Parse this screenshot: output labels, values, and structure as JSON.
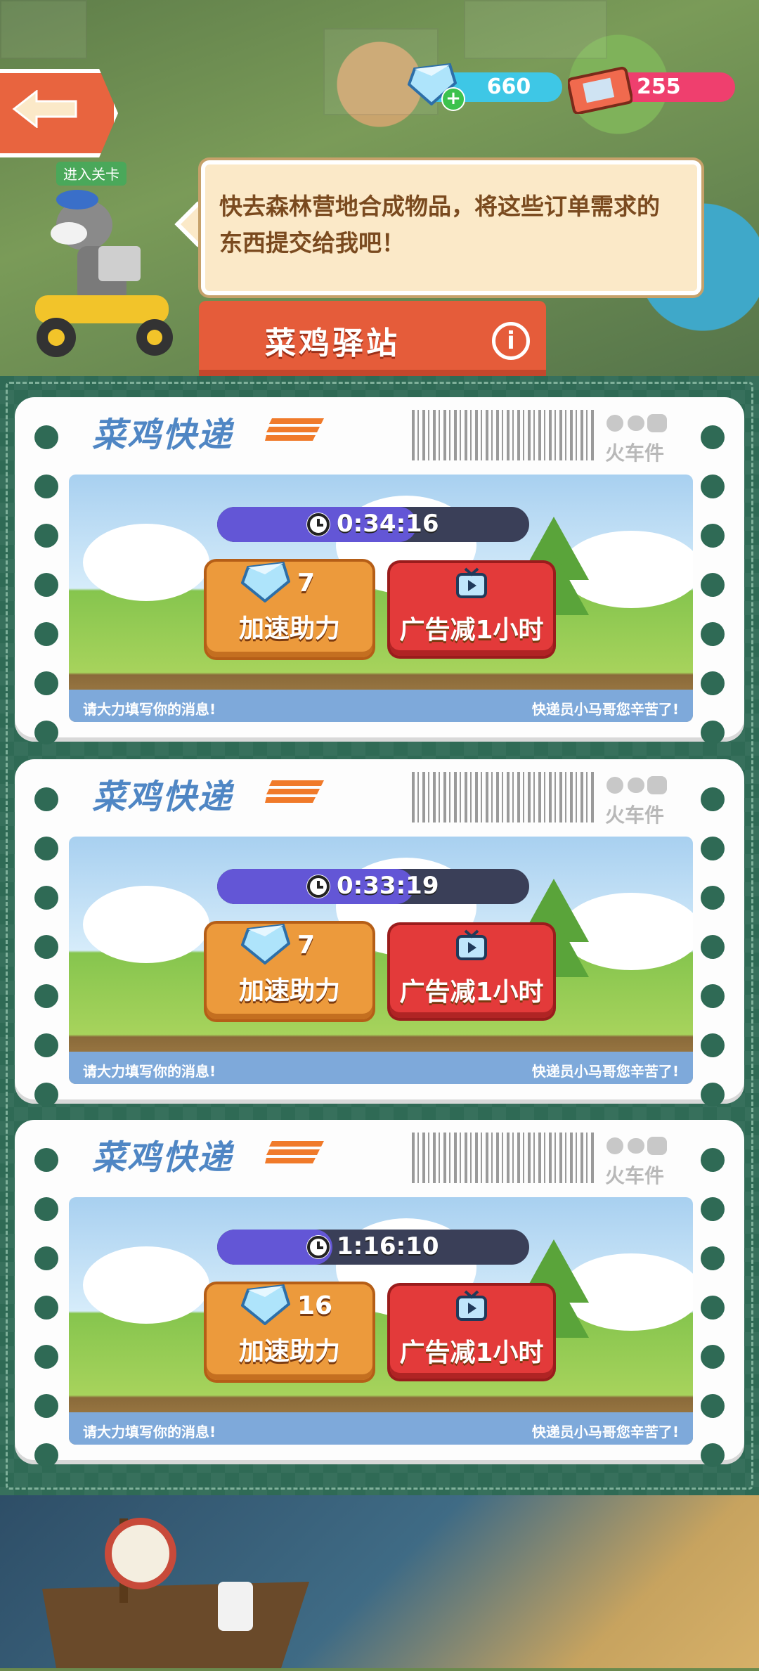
{
  "colors": {
    "accent": "#e55c3a",
    "panel": "#2f6a55",
    "brand_blue": "#4f86c4",
    "timer_fill": "#6356d6"
  },
  "header": {
    "back_icon": "back-arrow-icon",
    "gems": "660",
    "tickets": "255",
    "plus_symbol": "+",
    "speech": "快去森林营地合成物品，将这些订单需求的东西提交给我吧！",
    "title": "菜鸡驿站",
    "info_symbol": "i",
    "npc_sign": "进入关卡"
  },
  "cards": [
    {
      "brand": "菜鸡快递",
      "train_label": "火车件",
      "timer": "0:34:16",
      "timer_progress": 0.64,
      "speed_count": "7",
      "speed_label": "加速助力",
      "ad_label": "广告减1小时",
      "caption_left": "请大力填写你的消息!",
      "caption_right": "快递员小马哥您辛苦了!"
    },
    {
      "brand": "菜鸡快递",
      "train_label": "火车件",
      "timer": "0:33:19",
      "timer_progress": 0.63,
      "speed_count": "7",
      "speed_label": "加速助力",
      "ad_label": "广告减1小时",
      "caption_left": "请大力填写你的消息!",
      "caption_right": "快递员小马哥您辛苦了!"
    },
    {
      "brand": "菜鸡快递",
      "train_label": "火车件",
      "timer": "1:16:10",
      "timer_progress": 0.37,
      "speed_count": "16",
      "speed_label": "加速助力",
      "ad_label": "广告减1小时",
      "caption_left": "请大力填写你的消息!",
      "caption_right": "快递员小马哥您辛苦了!"
    }
  ]
}
